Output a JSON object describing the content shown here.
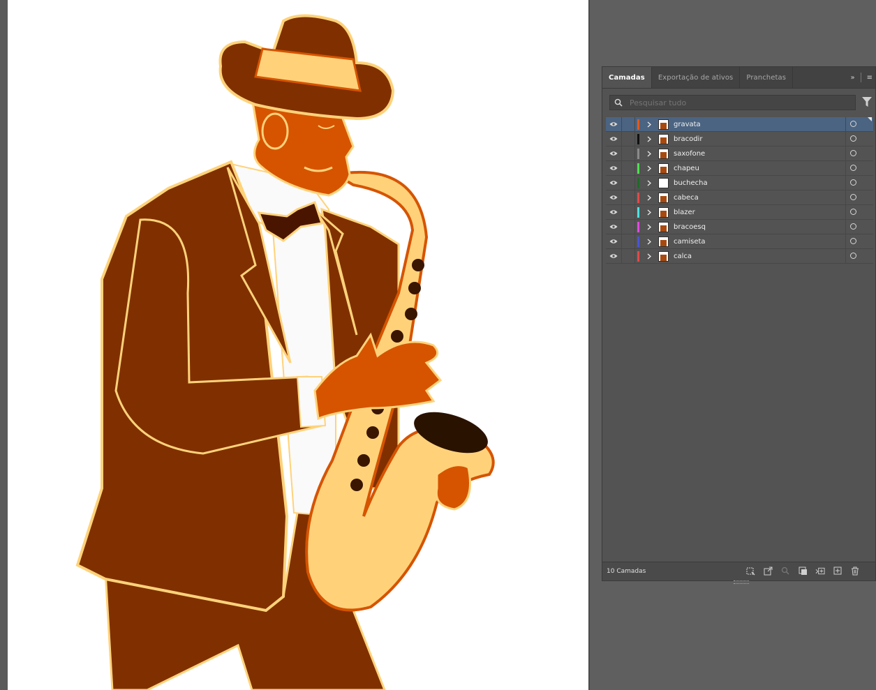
{
  "panel": {
    "tabs": [
      {
        "label": "Camadas",
        "active": true
      },
      {
        "label": "Exportação de ativos",
        "active": false
      },
      {
        "label": "Pranchetas",
        "active": false
      }
    ],
    "search_placeholder": "Pesquisar tudo",
    "layers": [
      {
        "name": "gravata",
        "color": "#e05a1b",
        "selected": true
      },
      {
        "name": "bracodir",
        "color": "#111111",
        "selected": false
      },
      {
        "name": "saxofone",
        "color": "#8a8a8a",
        "selected": false
      },
      {
        "name": "chapeu",
        "color": "#4ee04e",
        "selected": false
      },
      {
        "name": "buchecha",
        "color": "#1f6b2a",
        "selected": false
      },
      {
        "name": "cabeca",
        "color": "#e04a4a",
        "selected": false
      },
      {
        "name": "blazer",
        "color": "#4ee0e0",
        "selected": false
      },
      {
        "name": "bracoesq",
        "color": "#e04ae0",
        "selected": false
      },
      {
        "name": "camiseta",
        "color": "#4a55d6",
        "selected": false
      },
      {
        "name": "calca",
        "color": "#e04a4a",
        "selected": false
      }
    ],
    "footer_count": "10 Camadas"
  },
  "colors": {
    "brown": "#803000",
    "orange": "#d65400",
    "cream": "#ffd27a",
    "selected_row": "#4b6482"
  }
}
